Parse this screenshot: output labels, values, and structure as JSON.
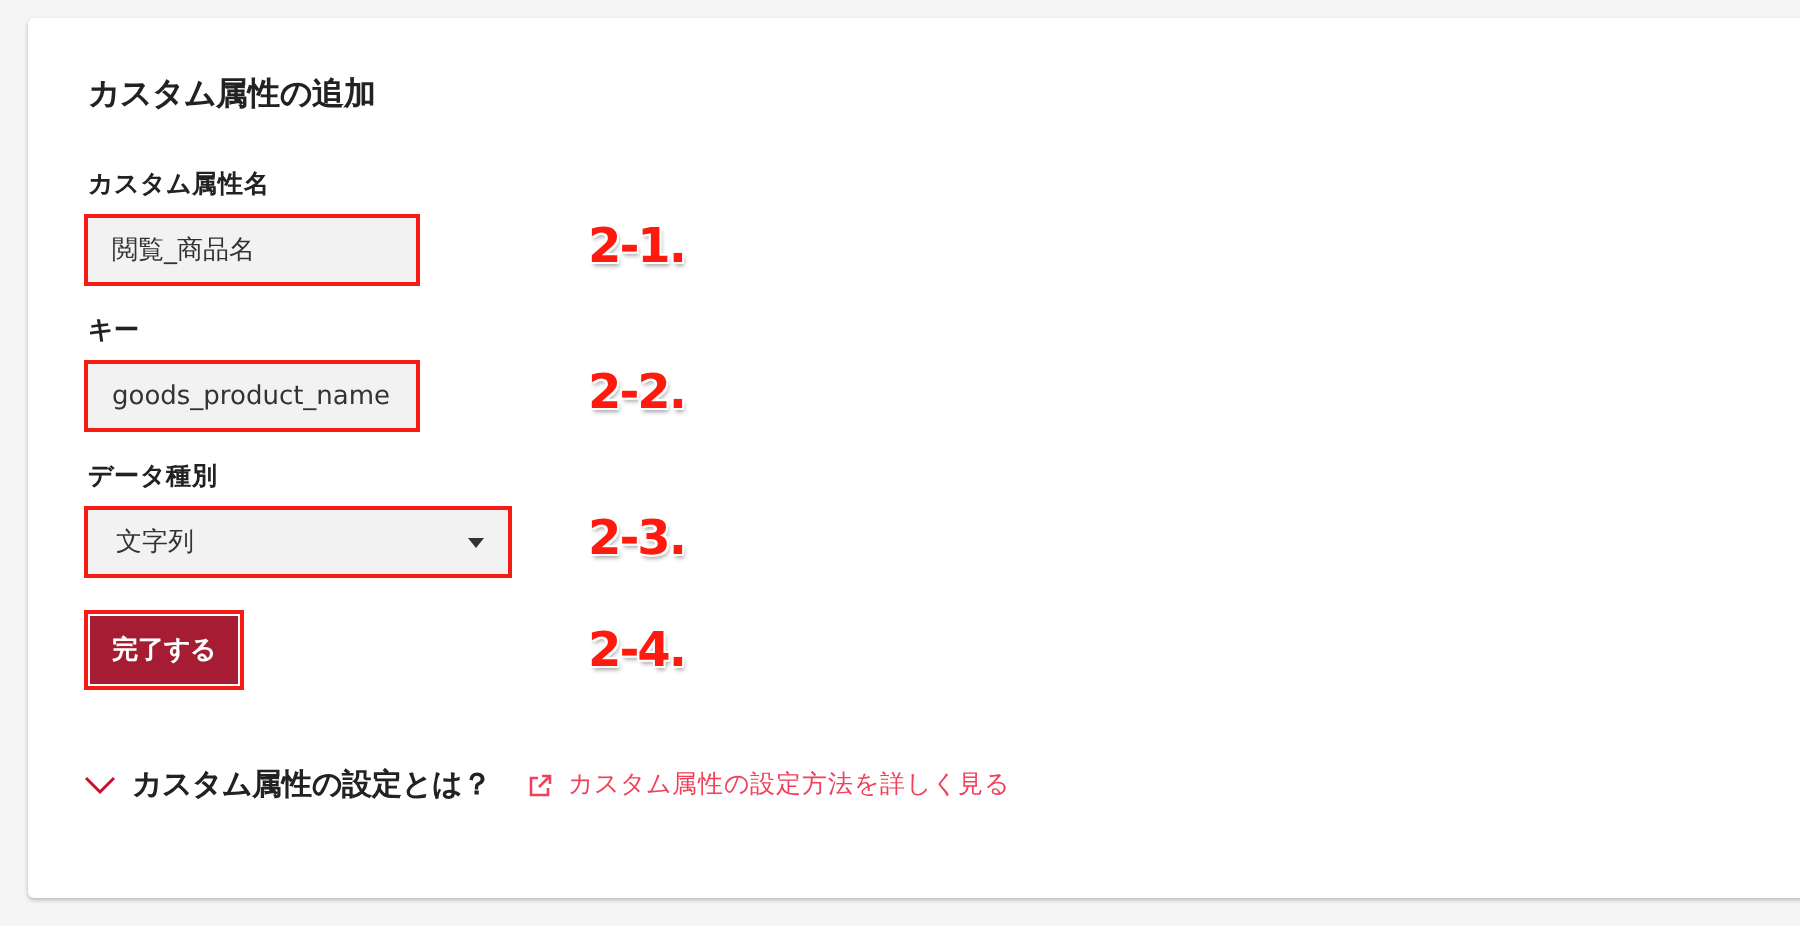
{
  "title": "カスタム属性の追加",
  "fields": [
    {
      "kind": "text",
      "label": "カスタム属性名",
      "value": "閲覧_商品名",
      "highlighted": true,
      "annotation": "2-1."
    },
    {
      "kind": "text",
      "label": "キー",
      "value": "goods_product_name",
      "highlighted": true,
      "annotation": "2-2."
    },
    {
      "kind": "select",
      "label": "データ種別",
      "value": "文字列",
      "highlighted": true,
      "annotation": "2-3."
    },
    {
      "kind": "button",
      "label": "完了する",
      "highlighted": true,
      "annotation": "2-4."
    }
  ],
  "help": {
    "toggle": "カスタム属性の設定とは？",
    "link": "カスタム属性の設定方法を詳しく見る"
  }
}
